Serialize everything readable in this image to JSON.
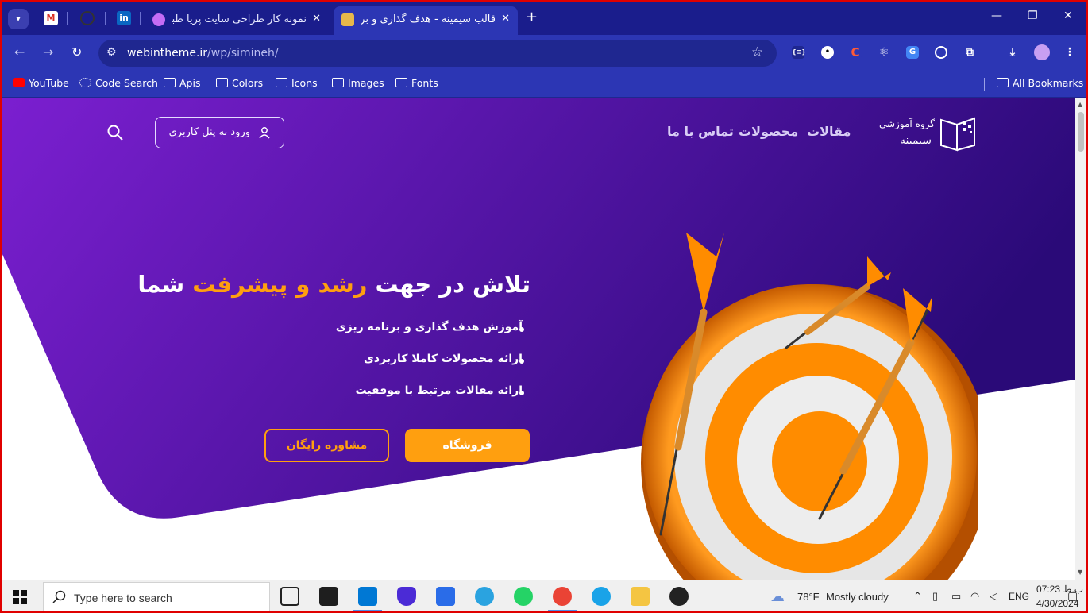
{
  "browser": {
    "tabs": [
      {
        "title": "نمونه کار طراحی سایت پریا طبیبیا",
        "active": false
      },
      {
        "title": "قالب سیمینه - هدف گذاری و برنامه",
        "active": true
      }
    ],
    "new_tab_symbol": "+",
    "address": {
      "domain": "webintheme.ir",
      "path": "/wp/simineh/"
    },
    "bookmarks": [
      "YouTube",
      "Code Search",
      "Apis",
      "Colors",
      "Icons",
      "Images",
      "Fonts"
    ],
    "all_bookmarks_label": "All Bookmarks"
  },
  "site": {
    "logo": {
      "line1": "گروه آموزشی",
      "line2": "سیمینه"
    },
    "nav": [
      "مقالات",
      "محصولات",
      "تماس با ما"
    ],
    "login_label": "ورود به پنل کاربری",
    "headline": {
      "part1": "تلاش در جهت",
      "highlight": "رشد و پیشرفت",
      "part2": "شما"
    },
    "bullets": [
      "آموزش هدف گذاری و برنامه ریزی",
      "ارائه محصولات کاملا کاربردی",
      "ارائه مقالات مرتبط با موفقیت"
    ],
    "primary_button": "فروشگاه",
    "secondary_button": "مشاوره رایگان",
    "colors": {
      "accent": "#ff9f0f",
      "hero_start": "#7b1fd0",
      "hero_end": "#2a0a78"
    }
  },
  "taskbar": {
    "search_placeholder": "Type here to search",
    "weather": {
      "temp": "78°F",
      "condition": "Mostly cloudy"
    },
    "language": "ENG",
    "time": "07:23 ب.ظ",
    "date": "4/30/2024"
  }
}
